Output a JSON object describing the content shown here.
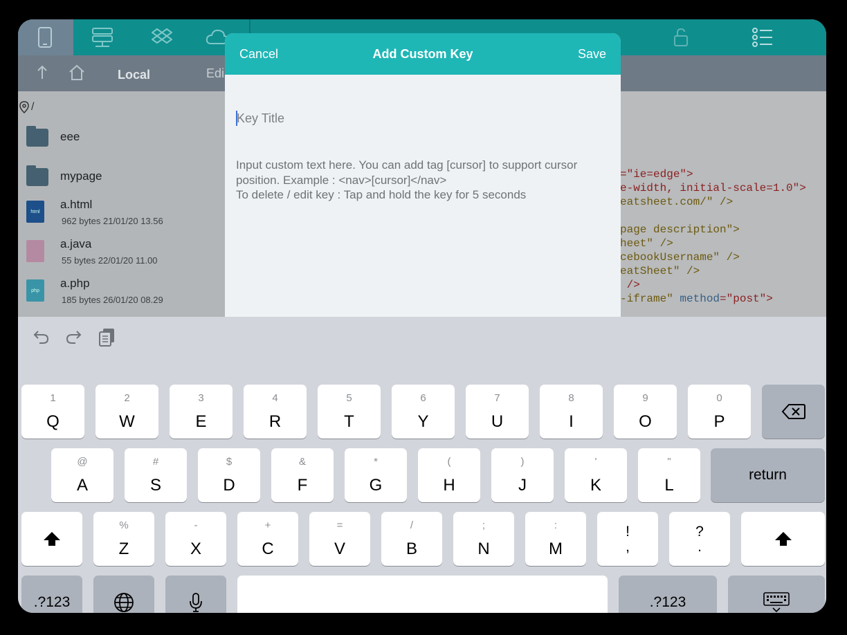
{
  "background_app": {
    "sidebar_tab": "Local",
    "edit_label": "Edi",
    "path": "/",
    "files": [
      {
        "name": "eee",
        "kind": "folder",
        "meta": ""
      },
      {
        "name": "mypage",
        "kind": "folder",
        "meta": ""
      },
      {
        "name": "a.html",
        "kind": "html",
        "icon_text": "html",
        "meta": "962 bytes 21/01/20 13.56"
      },
      {
        "name": "a.java",
        "kind": "java",
        "icon_text": "",
        "meta": "55 bytes 22/01/20 11.00"
      },
      {
        "name": "a.php",
        "kind": "php",
        "icon_text": "php",
        "meta": "185 bytes 26/01/20 08.29"
      }
    ],
    "code_lines": [
      [
        {
          "t": "=\"ie=edge\">",
          "c": "str"
        }
      ],
      [
        {
          "t": "e-width, initial-scale=1.0\">",
          "c": "str"
        }
      ],
      [
        {
          "t": "eatsheet.com/\" />",
          "c": "txt"
        }
      ],
      [
        {
          "t": "",
          "c": "txt"
        }
      ],
      [
        {
          "t": "page description\">",
          "c": "txt"
        }
      ],
      [
        {
          "t": "heet\" />",
          "c": "txt"
        }
      ],
      [
        {
          "t": "cebookUsername\" />",
          "c": "txt"
        }
      ],
      [
        {
          "t": "eatSheet\" />",
          "c": "txt"
        }
      ],
      [
        {
          "t": " />",
          "c": "str"
        }
      ],
      [
        {
          "t": "-iframe\" ",
          "c": "txt"
        },
        {
          "t": "method",
          "c": "attr"
        },
        {
          "t": "=\"post\">",
          "c": "str"
        }
      ]
    ]
  },
  "modal": {
    "cancel_label": "Cancel",
    "title": "Add Custom Key",
    "save_label": "Save",
    "key_title_placeholder": "Key Title",
    "key_title_value": "",
    "custom_text_placeholder": "Input custom text here. You can add tag [cursor] to support cursor position. Example : <nav>[cursor]</nav>\nTo delete / edit key : Tap and hold the key for 5 seconds",
    "custom_text_value": ""
  },
  "keyboard": {
    "row1": [
      {
        "alt": "1",
        "main": "Q"
      },
      {
        "alt": "2",
        "main": "W"
      },
      {
        "alt": "3",
        "main": "E"
      },
      {
        "alt": "4",
        "main": "R"
      },
      {
        "alt": "5",
        "main": "T"
      },
      {
        "alt": "6",
        "main": "Y"
      },
      {
        "alt": "7",
        "main": "U"
      },
      {
        "alt": "8",
        "main": "I"
      },
      {
        "alt": "9",
        "main": "O"
      },
      {
        "alt": "0",
        "main": "P"
      }
    ],
    "row2": [
      {
        "alt": "@",
        "main": "A"
      },
      {
        "alt": "#",
        "main": "S"
      },
      {
        "alt": "$",
        "main": "D"
      },
      {
        "alt": "&",
        "main": "F"
      },
      {
        "alt": "*",
        "main": "G"
      },
      {
        "alt": "(",
        "main": "H"
      },
      {
        "alt": ")",
        "main": "J"
      },
      {
        "alt": "'",
        "main": "K"
      },
      {
        "alt": "\"",
        "main": "L"
      }
    ],
    "row3": [
      {
        "alt": "%",
        "main": "Z"
      },
      {
        "alt": "-",
        "main": "X"
      },
      {
        "alt": "+",
        "main": "C"
      },
      {
        "alt": "=",
        "main": "V"
      },
      {
        "alt": "/",
        "main": "B"
      },
      {
        "alt": ";",
        "main": "N"
      },
      {
        "alt": ":",
        "main": "M"
      }
    ],
    "punct1": {
      "top": "!",
      "bottom": ","
    },
    "punct2": {
      "top": "?",
      "bottom": "."
    },
    "return_label": "return",
    "numbers_label": ".?123",
    "icons": {
      "undo": "undo-icon",
      "redo": "redo-icon",
      "paste": "clipboard-icon",
      "delete": "delete-backward-icon",
      "shift": "shift-icon",
      "globe": "globe-icon",
      "mic": "microphone-icon",
      "dismiss": "keyboard-dismiss-icon"
    }
  }
}
